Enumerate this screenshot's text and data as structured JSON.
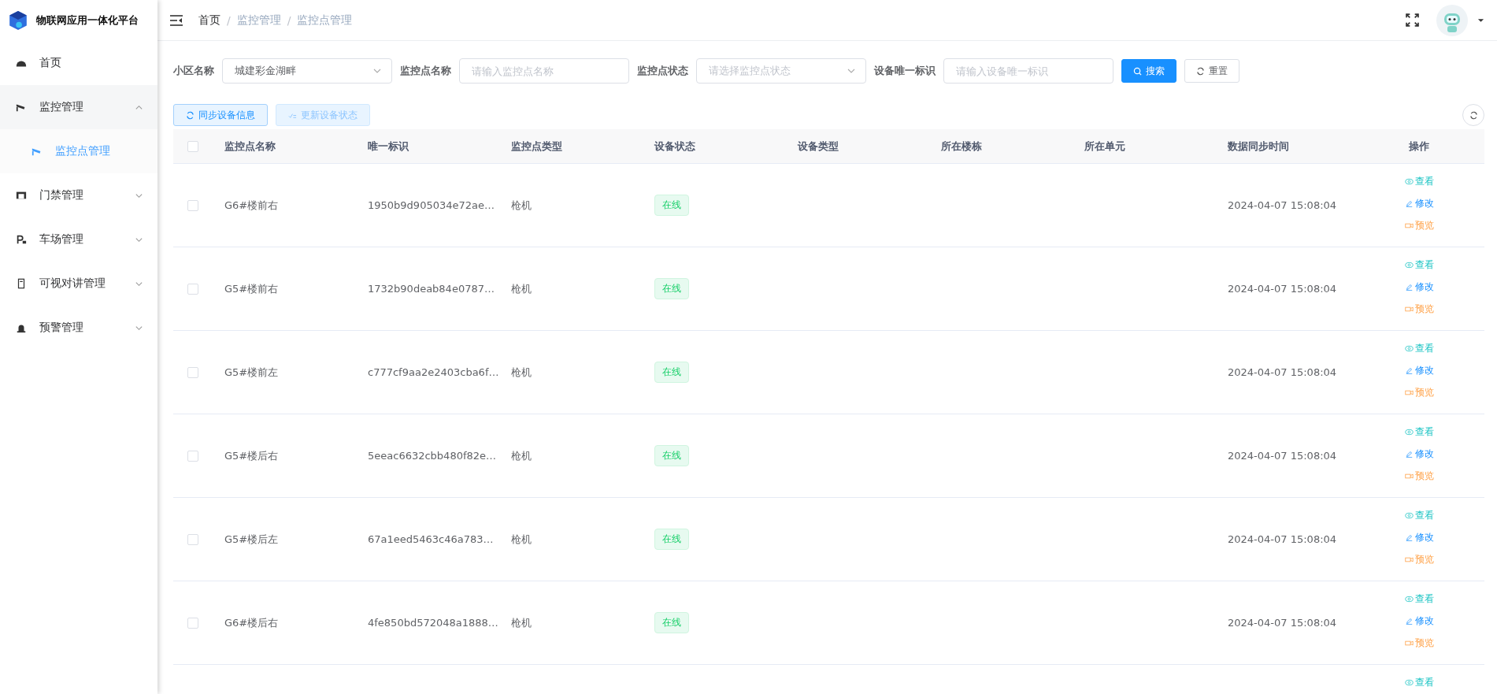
{
  "app": {
    "title": "物联网应用一体化平台"
  },
  "sidebar": {
    "items": [
      {
        "label": "首页",
        "kind": "link",
        "selected": false
      },
      {
        "label": "监控管理",
        "kind": "group",
        "expanded": true,
        "children": [
          {
            "label": "监控点管理",
            "selected": true
          }
        ]
      },
      {
        "label": "门禁管理",
        "kind": "group",
        "expanded": false
      },
      {
        "label": "车场管理",
        "kind": "group",
        "expanded": false
      },
      {
        "label": "可视对讲管理",
        "kind": "group",
        "expanded": false
      },
      {
        "label": "预警管理",
        "kind": "group",
        "expanded": false
      }
    ]
  },
  "breadcrumb": [
    {
      "label": "首页"
    },
    {
      "separator": "/",
      "label": "监控管理"
    },
    {
      "separator": "/",
      "label": "监控点管理"
    }
  ],
  "filters": [
    {
      "label": "小区名称",
      "kind": "select",
      "value": "城建彩金湖畔"
    },
    {
      "label": "监控点名称",
      "kind": "input",
      "placeholder": "请输入监控点名称"
    },
    {
      "label": "监控点状态",
      "kind": "select",
      "placeholder": "请选择监控点状态"
    },
    {
      "label": "设备唯一标识",
      "kind": "input",
      "placeholder": "请输入设备唯一标识"
    }
  ],
  "search_button": "搜索",
  "reset_button": "重置",
  "toolbar": [
    {
      "label": "同步设备信息",
      "kind": "sync",
      "disabled": false
    },
    {
      "label": "更新设备状态",
      "kind": "update",
      "disabled": true
    }
  ],
  "table": {
    "header_checked": false,
    "columns": [
      "监控点名称",
      "唯一标识",
      "监控点类型",
      "设备状态",
      "设备类型",
      "所在楼栋",
      "所在单元",
      "数据同步时间",
      "操作"
    ],
    "rows": [
      {
        "checked": false,
        "name": "G6#楼前右",
        "id": "1950b9d905034e72ae…",
        "type": "枪机",
        "status": {
          "label": "在线",
          "kind": "online"
        },
        "time": "2024-04-07 15:08:04",
        "actions": [
          {
            "label": "查看",
            "kind": "view"
          },
          {
            "label": "修改",
            "kind": "edit"
          },
          {
            "label": "预览",
            "kind": "preview"
          }
        ]
      },
      {
        "checked": false,
        "name": "G5#楼前右",
        "id": "1732b90deab84e0787…",
        "type": "枪机",
        "status": {
          "label": "在线",
          "kind": "online"
        },
        "time": "2024-04-07 15:08:04",
        "actions": [
          {
            "label": "查看",
            "kind": "view"
          },
          {
            "label": "修改",
            "kind": "edit"
          },
          {
            "label": "预览",
            "kind": "preview"
          }
        ]
      },
      {
        "checked": false,
        "name": "G5#楼前左",
        "id": "c777cf9aa2e2403cba6f…",
        "type": "枪机",
        "status": {
          "label": "在线",
          "kind": "online"
        },
        "time": "2024-04-07 15:08:04",
        "actions": [
          {
            "label": "查看",
            "kind": "view"
          },
          {
            "label": "修改",
            "kind": "edit"
          },
          {
            "label": "预览",
            "kind": "preview"
          }
        ]
      },
      {
        "checked": false,
        "name": "G5#楼后右",
        "id": "5eeac6632cbb480f82e…",
        "type": "枪机",
        "status": {
          "label": "在线",
          "kind": "online"
        },
        "time": "2024-04-07 15:08:04",
        "actions": [
          {
            "label": "查看",
            "kind": "view"
          },
          {
            "label": "修改",
            "kind": "edit"
          },
          {
            "label": "预览",
            "kind": "preview"
          }
        ]
      },
      {
        "checked": false,
        "name": "G5#楼后左",
        "id": "67a1eed5463c46a783…",
        "type": "枪机",
        "status": {
          "label": "在线",
          "kind": "online"
        },
        "time": "2024-04-07 15:08:04",
        "actions": [
          {
            "label": "查看",
            "kind": "view"
          },
          {
            "label": "修改",
            "kind": "edit"
          },
          {
            "label": "预览",
            "kind": "preview"
          }
        ]
      },
      {
        "checked": false,
        "name": "G6#楼后右",
        "id": "4fe850bd572048a1888…",
        "type": "枪机",
        "status": {
          "label": "在线",
          "kind": "online"
        },
        "time": "2024-04-07 15:08:04",
        "actions": [
          {
            "label": "查看",
            "kind": "view"
          },
          {
            "label": "修改",
            "kind": "edit"
          },
          {
            "label": "预览",
            "kind": "preview"
          }
        ]
      },
      {
        "actions": [
          {
            "label": "查看",
            "kind": "view"
          }
        ]
      }
    ]
  }
}
